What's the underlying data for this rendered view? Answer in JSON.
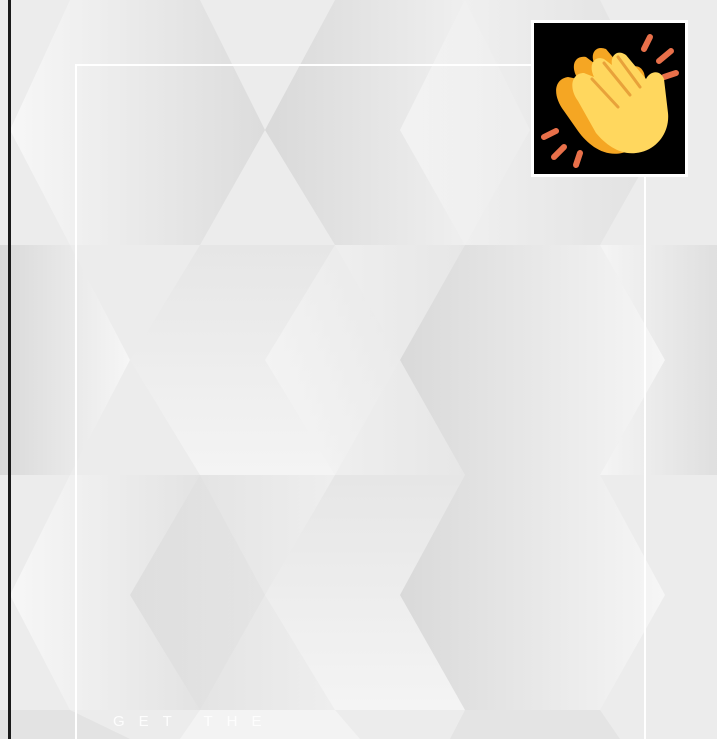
{
  "caption": {
    "text": "GET THE"
  },
  "emoji": {
    "icon": "clapping-hands-icon",
    "colors": {
      "hand_front": "#FFD75E",
      "hand_back": "#F5A623",
      "sparks": "#E8704A",
      "background": "#000000"
    }
  },
  "background": {
    "pattern": "hexagon",
    "colors": {
      "light": "#F2F2F2",
      "mid": "#DEDEDE",
      "frame": "#FFFFFF"
    }
  }
}
